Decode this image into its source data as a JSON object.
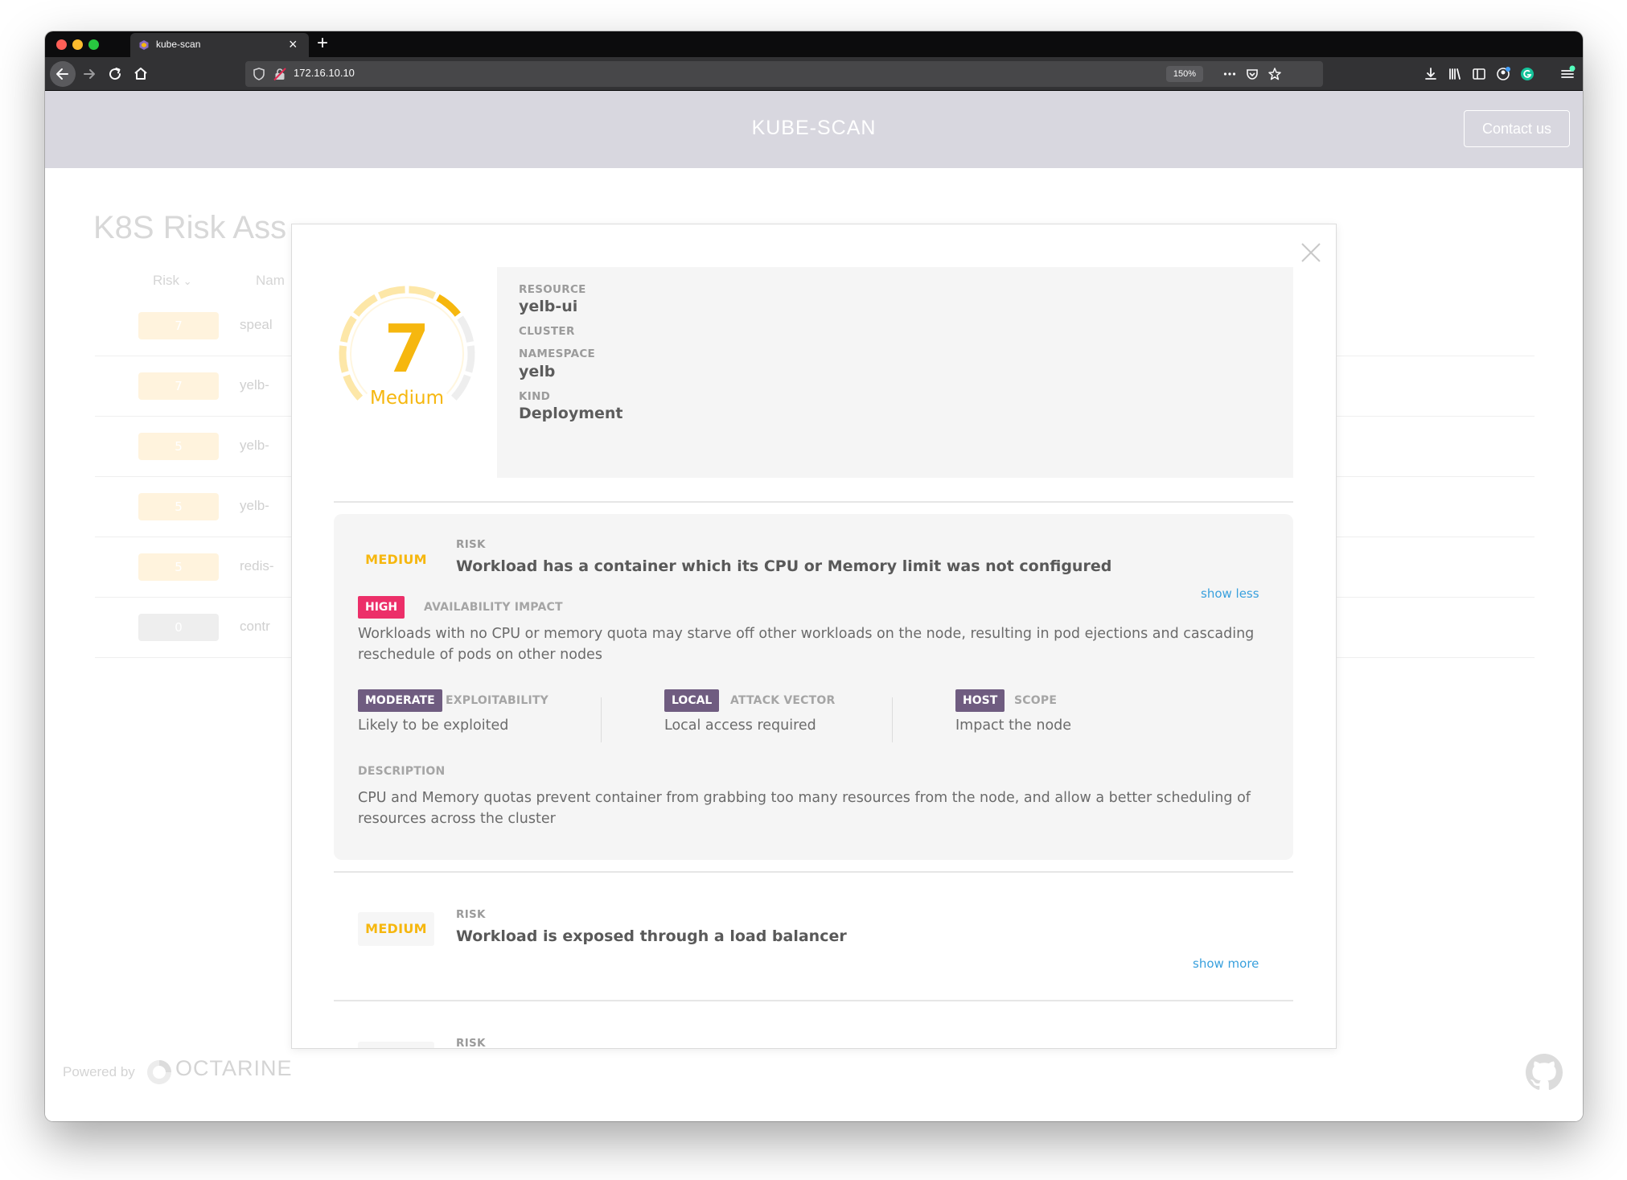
{
  "browser": {
    "tab_title": "kube-scan",
    "tab_close": "×",
    "new_tab": "+",
    "url": "172.16.10.10",
    "zoom": "150%",
    "colors": {
      "close": "#ff5f57",
      "minimize": "#febc2e",
      "maximize": "#28c840"
    }
  },
  "app": {
    "title": "KUBE-SCAN",
    "contact_label": "Contact us",
    "background_title": "K8S Risk Ass",
    "columns": {
      "risk": "Risk",
      "name": "Nam"
    },
    "rows": [
      {
        "score": "7",
        "name": "speal",
        "color": "#fff3dd"
      },
      {
        "score": "7",
        "name": "yelb-",
        "color": "#fff3dd"
      },
      {
        "score": "5",
        "name": "yelb-",
        "color": "#fff3dd"
      },
      {
        "score": "5",
        "name": "yelb-",
        "color": "#fff3dd"
      },
      {
        "score": "5",
        "name": "redis-",
        "color": "#fff3dd"
      },
      {
        "score": "0",
        "name": "contr",
        "color": "#eeeeee"
      }
    ],
    "powered_by": "Powered by",
    "brand": "OCTARINE"
  },
  "modal": {
    "score": {
      "value": "7",
      "label": "Medium",
      "max": 10,
      "color": "#f6b70f"
    },
    "resource": {
      "resource_label": "RESOURCE",
      "resource_value": "yelb-ui",
      "cluster_label": "CLUSTER",
      "namespace_label": "NAMESPACE",
      "namespace_value": "yelb",
      "kind_label": "KIND",
      "kind_value": "Deployment"
    },
    "risks": [
      {
        "severity": "MEDIUM",
        "risk_label": "RISK",
        "title": "Workload has a container which its CPU or Memory limit was not configured",
        "toggle": "show less",
        "impact_tag": "HIGH",
        "impact_caption": "AVAILABILITY IMPACT",
        "impact_text": "Workloads with no CPU or memory quota may starve off other workloads on the node, resulting in pod ejections and cascading reschedule of pods on other nodes",
        "factors": [
          {
            "tag": "MODERATE",
            "caption": "EXPLOITABILITY",
            "text": "Likely to be exploited"
          },
          {
            "tag": "LOCAL",
            "caption": "ATTACK VECTOR",
            "text": "Local access required"
          },
          {
            "tag": "HOST",
            "caption": "SCOPE",
            "text": "Impact the node"
          }
        ],
        "description_label": "DESCRIPTION",
        "description": "CPU and Memory quotas prevent container from grabbing too many resources from the node, and allow a better scheduling of resources across the cluster"
      },
      {
        "severity": "MEDIUM",
        "risk_label": "RISK",
        "title": "Workload is exposed through a load balancer",
        "toggle": "show more"
      },
      {
        "risk_label": "RISK"
      }
    ]
  }
}
